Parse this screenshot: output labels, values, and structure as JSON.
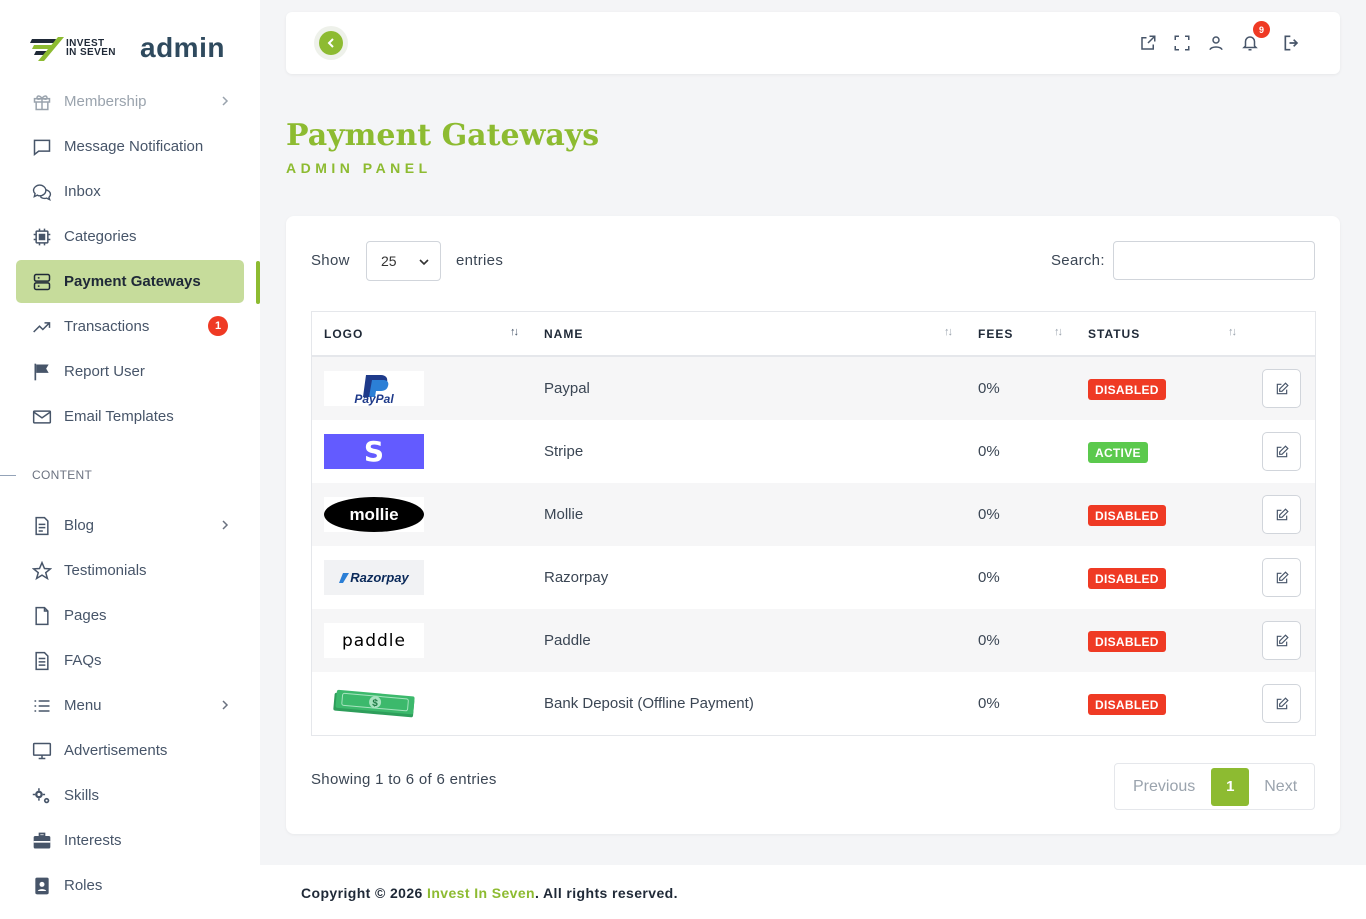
{
  "brand": {
    "line1": "INVEST",
    "line2": "IN SEVEN",
    "admin": "admin"
  },
  "sidebar": {
    "items": [
      {
        "label": "Membership",
        "icon": "gift-icon",
        "chevron": true,
        "faded": true
      },
      {
        "label": "Message Notification",
        "icon": "message-square-icon"
      },
      {
        "label": "Inbox",
        "icon": "chat-bubbles-icon"
      },
      {
        "label": "Categories",
        "icon": "cpu-chip-icon"
      },
      {
        "label": "Payment Gateways",
        "icon": "server-icon",
        "active": true
      },
      {
        "label": "Transactions",
        "icon": "trending-up-icon",
        "badge": "1"
      },
      {
        "label": "Report User",
        "icon": "flag-icon"
      },
      {
        "label": "Email Templates",
        "icon": "mail-icon"
      }
    ],
    "section_label": "CONTENT",
    "content_items": [
      {
        "label": "Blog",
        "icon": "file-text-icon",
        "chevron": true
      },
      {
        "label": "Testimonials",
        "icon": "star-icon"
      },
      {
        "label": "Pages",
        "icon": "file-icon"
      },
      {
        "label": "FAQs",
        "icon": "file-list-icon"
      },
      {
        "label": "Menu",
        "icon": "list-icon",
        "chevron": true
      },
      {
        "label": "Advertisements",
        "icon": "monitor-icon"
      },
      {
        "label": "Skills",
        "icon": "gears-icon"
      },
      {
        "label": "Interests",
        "icon": "briefcase-icon"
      },
      {
        "label": "Roles",
        "icon": "id-badge-icon"
      }
    ]
  },
  "topbar": {
    "notification_count": "9"
  },
  "page": {
    "title": "Payment Gateways",
    "subtitle": "ADMIN PANEL"
  },
  "table_controls": {
    "show_label": "Show",
    "page_size": "25",
    "entries_label": "entries",
    "search_label": "Search:",
    "search_value": ""
  },
  "table": {
    "columns": [
      "LOGO",
      "NAME",
      "FEES",
      "STATUS"
    ],
    "rows": [
      {
        "logo": "PayPal",
        "name": "Paypal",
        "fees": "0%",
        "status": "DISABLED"
      },
      {
        "logo": "S",
        "name": "Stripe",
        "fees": "0%",
        "status": "ACTIVE"
      },
      {
        "logo": "mollie",
        "name": "Mollie",
        "fees": "0%",
        "status": "DISABLED"
      },
      {
        "logo": "Razorpay",
        "name": "Razorpay",
        "fees": "0%",
        "status": "DISABLED"
      },
      {
        "logo": "paddle",
        "name": "Paddle",
        "fees": "0%",
        "status": "DISABLED"
      },
      {
        "logo": "$",
        "name": "Bank Deposit (Offline Payment)",
        "fees": "0%",
        "status": "DISABLED"
      }
    ]
  },
  "pagination": {
    "info": "Showing 1 to 6 of 6 entries",
    "previous": "Previous",
    "current": "1",
    "next": "Next"
  },
  "footer": {
    "prefix": "Copyright © 2026 ",
    "brand": "Invest In Seven",
    "suffix": ". All rights reserved."
  },
  "colors": {
    "accent": "#8dbb31",
    "danger": "#ef3a24",
    "success": "#5bc94d",
    "active_bg": "#c6dc9b"
  }
}
